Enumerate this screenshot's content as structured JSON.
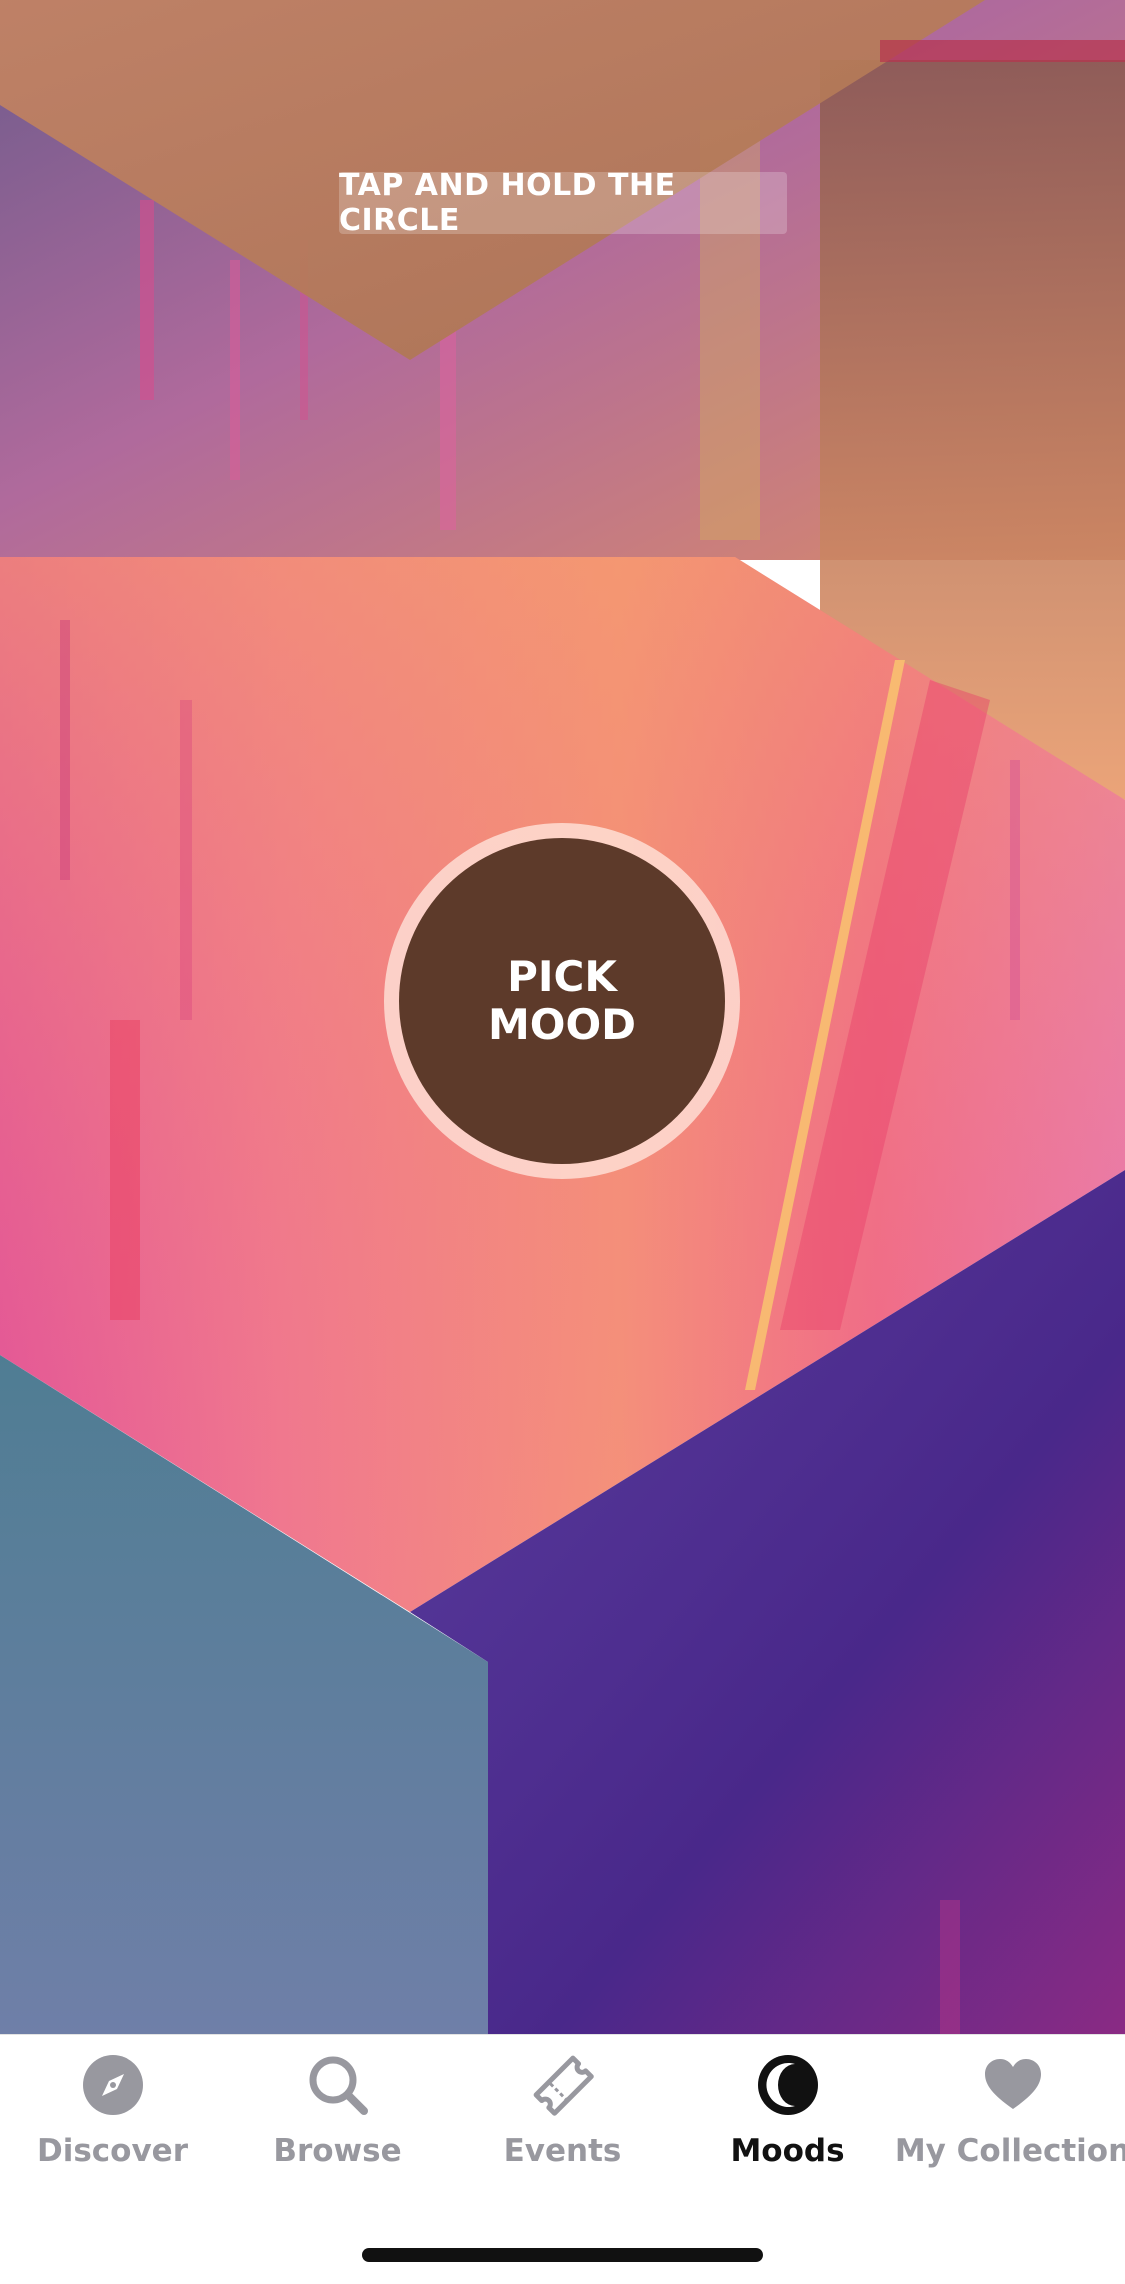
{
  "hint": {
    "text": "TAP AND HOLD THE CIRCLE"
  },
  "mood_button": {
    "line1": "PICK",
    "line2": "MOOD"
  },
  "tabbar": {
    "tabs": [
      {
        "label": "Discover",
        "icon": "compass-icon",
        "active": false
      },
      {
        "label": "Browse",
        "icon": "search-icon",
        "active": false
      },
      {
        "label": "Events",
        "icon": "ticket-icon",
        "active": false
      },
      {
        "label": "Moods",
        "icon": "moon-icon",
        "active": true
      },
      {
        "label": "My Collection",
        "icon": "heart-icon",
        "active": false
      }
    ]
  },
  "colors": {
    "active_tab": "#111111",
    "inactive_tab": "#98989f",
    "mood_circle": "#5d3a2a"
  }
}
